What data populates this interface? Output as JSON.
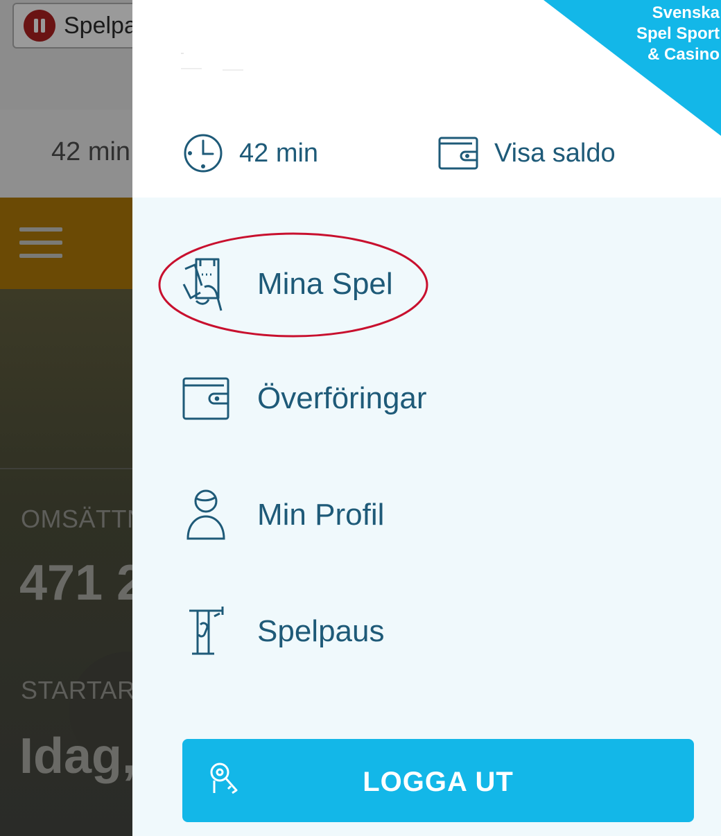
{
  "background": {
    "spelpaus_label": "Spelpaus",
    "time": "42 min",
    "omsattning_label": "OMSÄTTN",
    "omsattning_value": "471 2",
    "startar_label": "STARTAR:",
    "startar_value": "Idag,"
  },
  "drawer": {
    "brand_lines": [
      "Svenska",
      "Spel Sport",
      "& Casino"
    ],
    "session_time": "42 min",
    "balance_label": "Visa saldo",
    "menu": [
      {
        "label": "Mina Spel",
        "icon": "tickets-hand-icon",
        "highlighted": true
      },
      {
        "label": "Överföringar",
        "icon": "wallet-icon"
      },
      {
        "label": "Min Profil",
        "icon": "profile-icon"
      },
      {
        "label": "Spelpaus",
        "icon": "pause-stand-icon"
      }
    ],
    "logout_label": "LOGGA UT"
  },
  "colors": {
    "accent": "#13b7e8",
    "text": "#1e5a78",
    "highlight_ellipse": "#c8102e"
  }
}
